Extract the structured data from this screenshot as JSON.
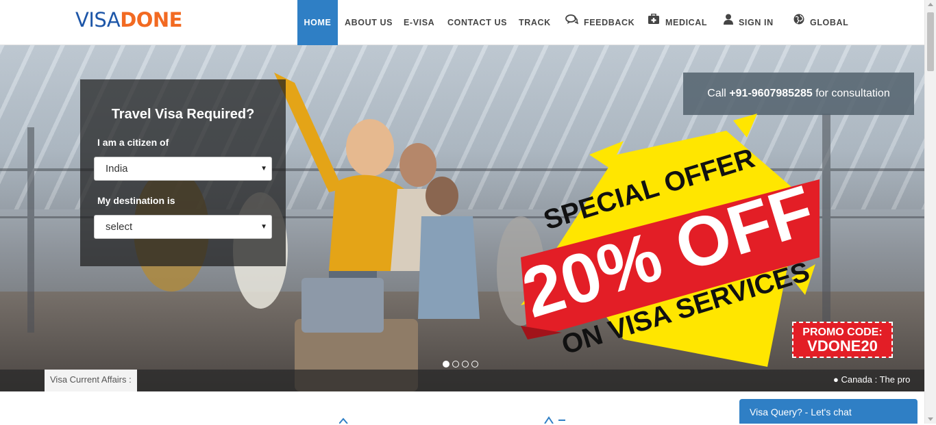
{
  "brand": {
    "logo_part1": "VISA",
    "logo_part2": "DONE",
    "color_blue": "#1d56a8",
    "color_orange": "#f26a22"
  },
  "nav": {
    "items": [
      {
        "label": "HOME",
        "active": true
      },
      {
        "label": "ABOUT US"
      },
      {
        "label": "E-VISA"
      },
      {
        "label": "CONTACT US"
      },
      {
        "label": "TRACK"
      },
      {
        "label": "FEEDBACK",
        "icon": "comments-icon"
      },
      {
        "label": "MEDICAL",
        "icon": "medkit-icon"
      },
      {
        "label": "SIGN IN",
        "icon": "user-icon"
      },
      {
        "label": "GLOBAL",
        "icon": "globe-icon"
      }
    ],
    "active_color": "#2f7fc5"
  },
  "form": {
    "title": "Travel Visa Required?",
    "citizen_label": "I am a citizen of",
    "citizen_value": "India",
    "destination_label": "My destination is",
    "destination_value": "select"
  },
  "call": {
    "prefix": "Call",
    "phone": "+91-9607985285",
    "suffix": "for consultation"
  },
  "offer": {
    "line1": "SPECIAL OFFER",
    "line2": "20% OFF",
    "line3": "ON VISA SERVICES",
    "promo_label": "PROMO CODE:",
    "promo_code": "VDONE20",
    "colors": {
      "yellow": "#ffe600",
      "red": "#e31e26"
    }
  },
  "carousel": {
    "slides": 4,
    "active_slide": 1
  },
  "ticker": {
    "label": "Visa Current Affairs :",
    "text": "● Canada : The pro"
  },
  "chat": {
    "label": "Visa Query? - Let's chat"
  }
}
